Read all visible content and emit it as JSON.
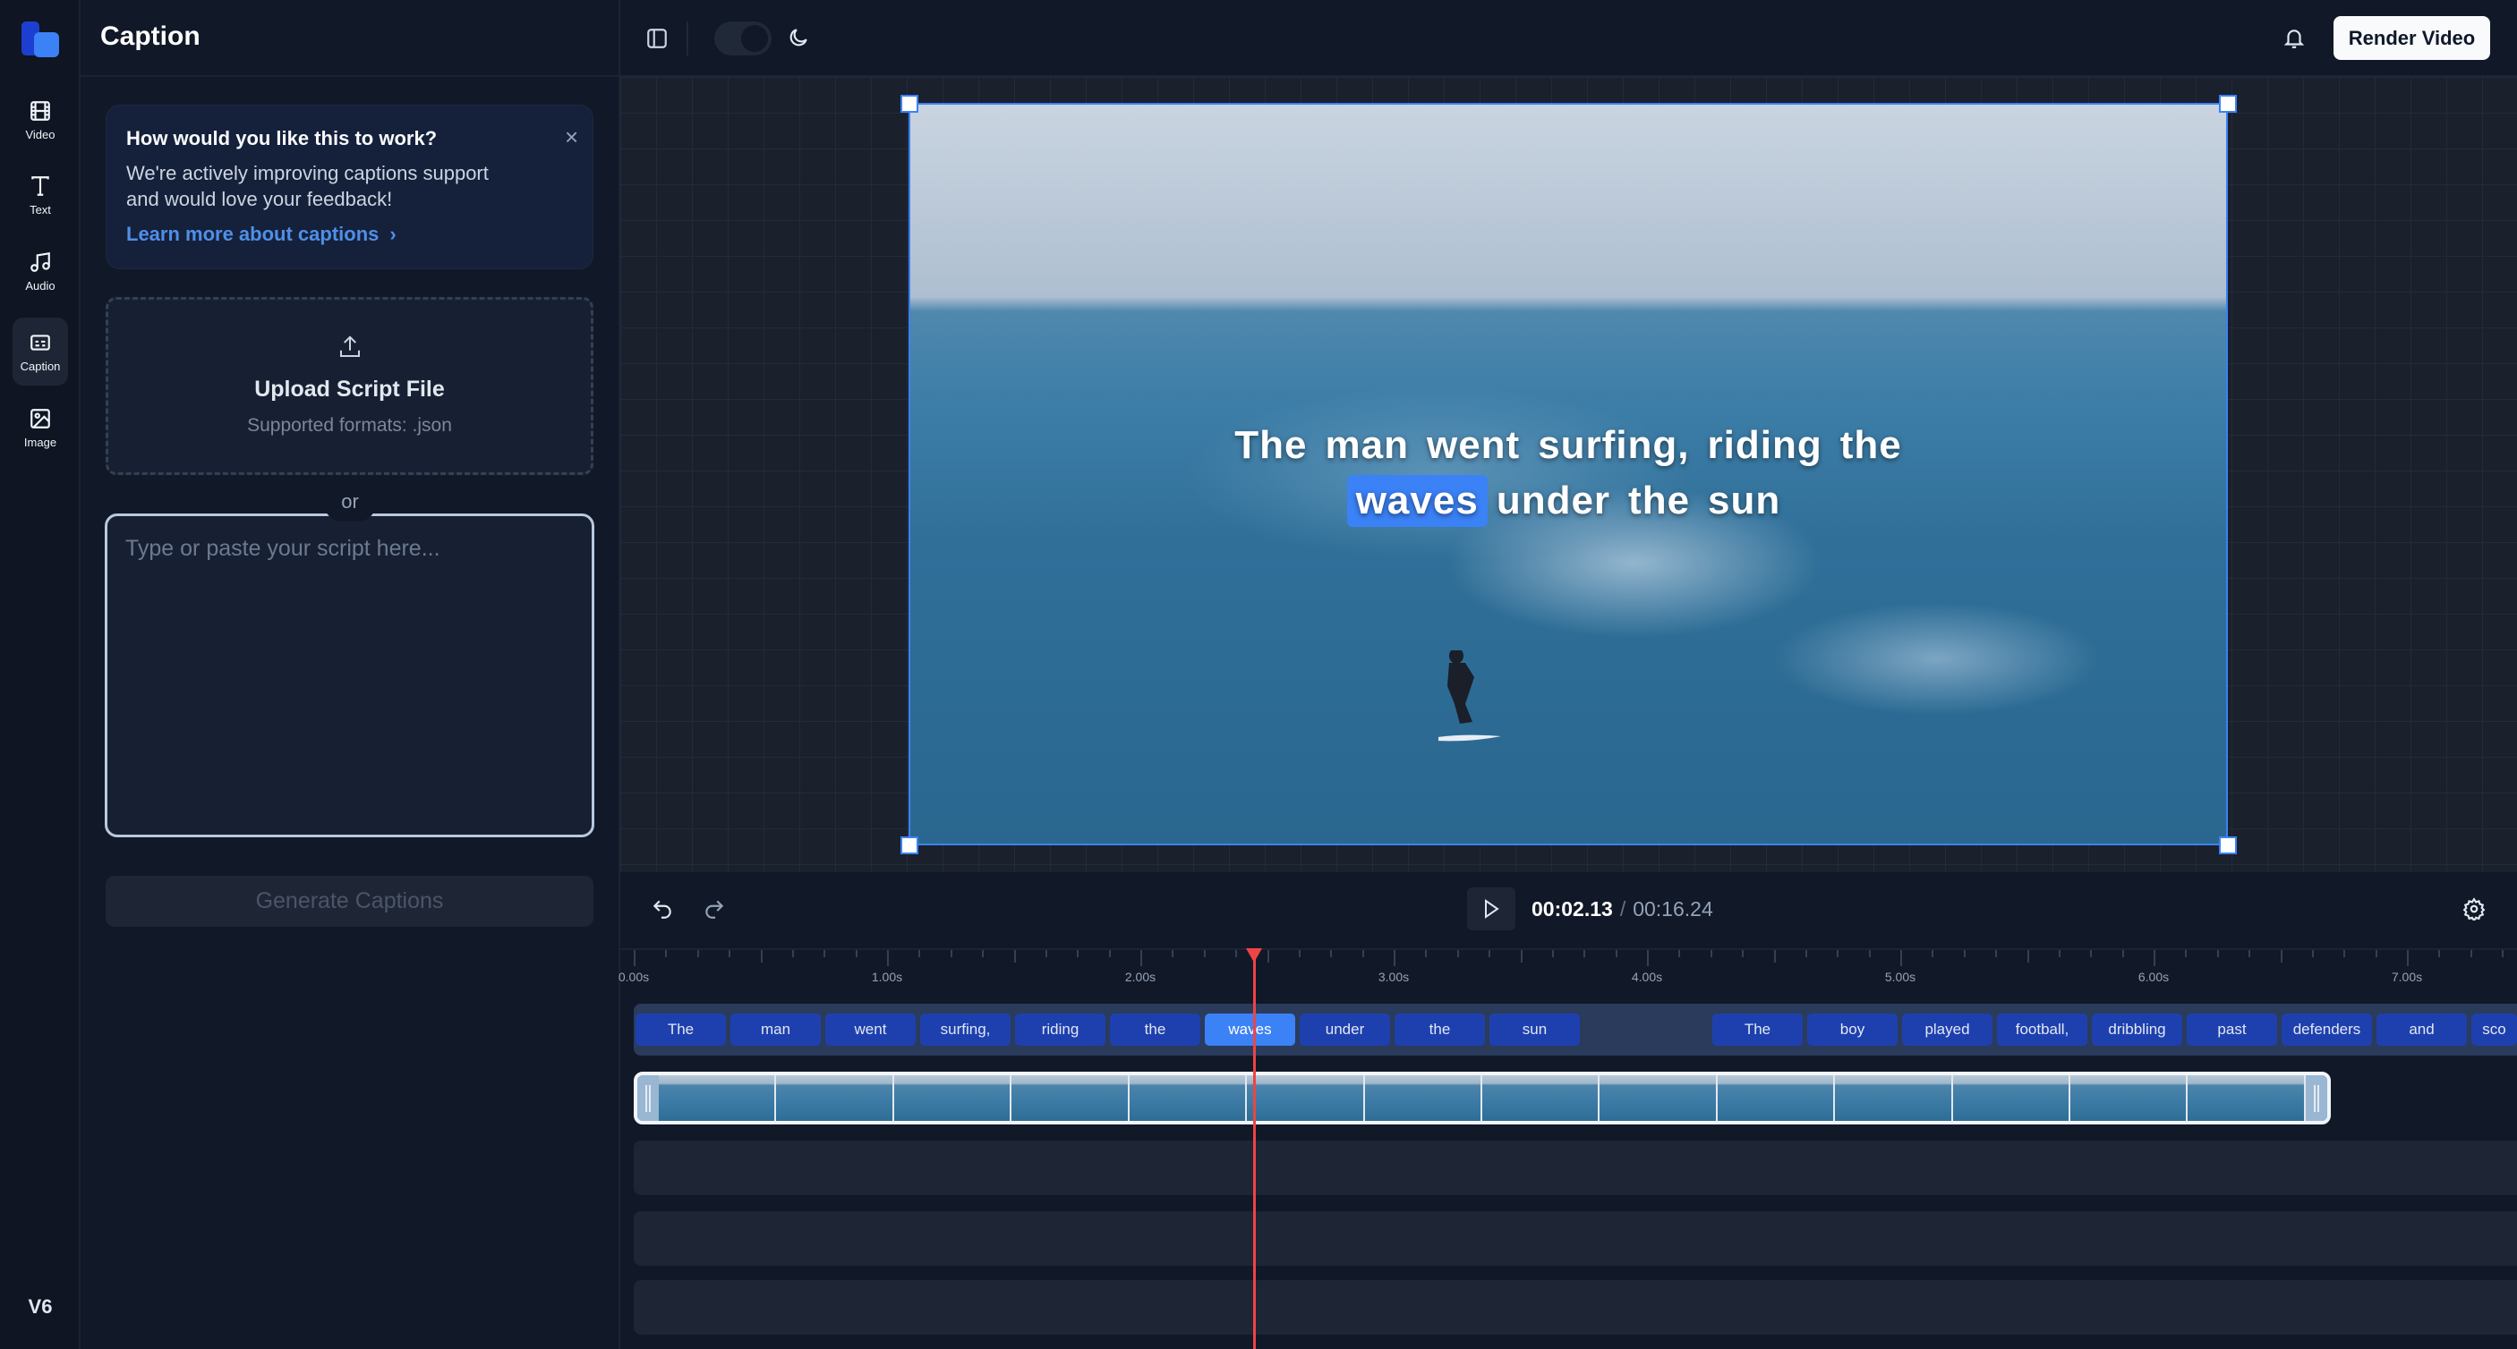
{
  "app": {
    "version": "V6",
    "logo_colors": [
      "#1d3fd1",
      "#3b82f6"
    ]
  },
  "rail": [
    {
      "label": "Video",
      "icon": "film-icon"
    },
    {
      "label": "Text",
      "icon": "text-icon"
    },
    {
      "label": "Audio",
      "icon": "music-icon"
    },
    {
      "label": "Caption",
      "icon": "caption-icon",
      "active": true
    },
    {
      "label": "Image",
      "icon": "image-icon"
    }
  ],
  "panel": {
    "title": "Caption",
    "info": {
      "title": "How would you like this to work?",
      "line1": "We're actively improving captions support",
      "line2": "and would love your feedback!",
      "link": "Learn more about captions"
    },
    "upload": {
      "title": "Upload Script File",
      "formats": "Supported formats: .json"
    },
    "or": "or",
    "script_placeholder": "Type or paste your script here...",
    "generate": "Generate Captions"
  },
  "topbar": {
    "render": "Render Video",
    "theme_toggle_on": false
  },
  "preview": {
    "caption_line1": [
      "The",
      "man",
      "went",
      "surfing,",
      "riding",
      "the"
    ],
    "caption_line2": [
      "waves",
      "under",
      "the",
      "sun"
    ],
    "highlight_word": "waves",
    "accent": "#3b82f6"
  },
  "player": {
    "current": "00:02.13",
    "separator": "/",
    "total": "00:16.24"
  },
  "ruler": [
    "0.00s",
    "1.00s",
    "2.00s",
    "3.00s",
    "4.00s",
    "5.00s",
    "6.00s",
    "7.00s"
  ],
  "captions": {
    "group1": [
      "The",
      "man",
      "went",
      "surfing,",
      "riding",
      "the",
      "waves",
      "under",
      "the",
      "sun"
    ],
    "group2": [
      "The",
      "boy",
      "played",
      "football,",
      "dribbling",
      "past",
      "defenders",
      "and",
      "sco"
    ],
    "active_word": "waves"
  }
}
